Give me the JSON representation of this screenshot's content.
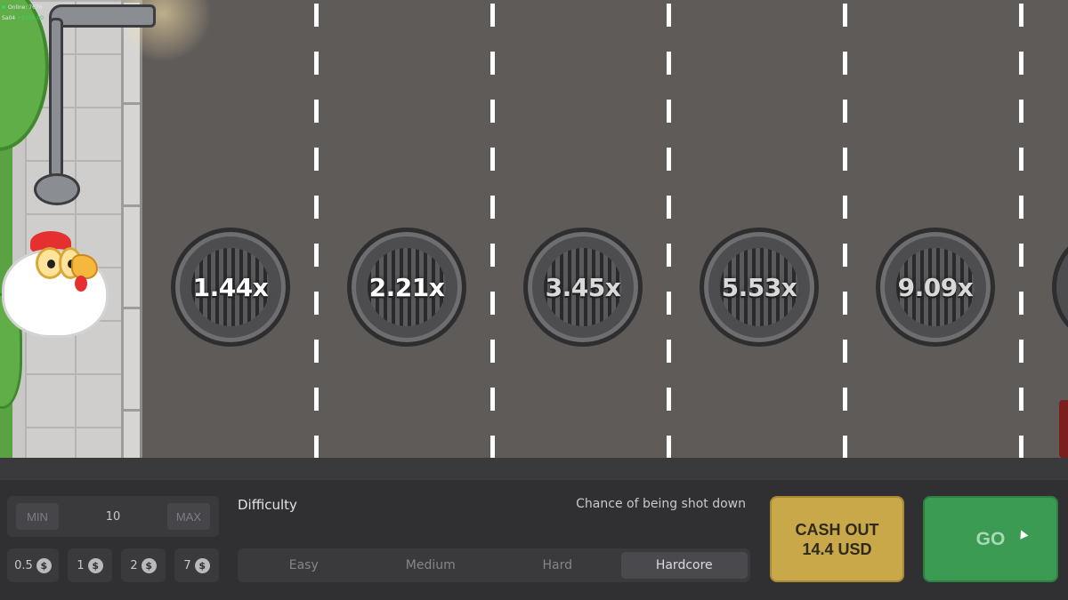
{
  "topinfo": {
    "line1": "Online: 7676",
    "line2_user": "Sa04",
    "line2_win": "+$150.00"
  },
  "multipliers": [
    "1.44x",
    "2.21x",
    "3.45x",
    "5.53x",
    "9.09x"
  ],
  "bet": {
    "min_label": "MIN",
    "max_label": "MAX",
    "value": "10"
  },
  "chips": [
    {
      "value": "0.5",
      "coin": "$"
    },
    {
      "value": "1",
      "coin": "$"
    },
    {
      "value": "2",
      "coin": "$"
    },
    {
      "value": "7",
      "coin": "$"
    }
  ],
  "difficulty": {
    "label": "Difficulty",
    "chance_label": "Chance of being shot down",
    "options": [
      "Easy",
      "Medium",
      "Hard",
      "Hardcore"
    ],
    "selected": "Hardcore"
  },
  "cashout": {
    "line1": "CASH OUT",
    "line2": "14.4 USD"
  },
  "go_label": "GO",
  "colors": {
    "cashout": "#c9a84a",
    "go": "#3b9b53",
    "road": "#5f5b59",
    "panel": "#303032"
  }
}
